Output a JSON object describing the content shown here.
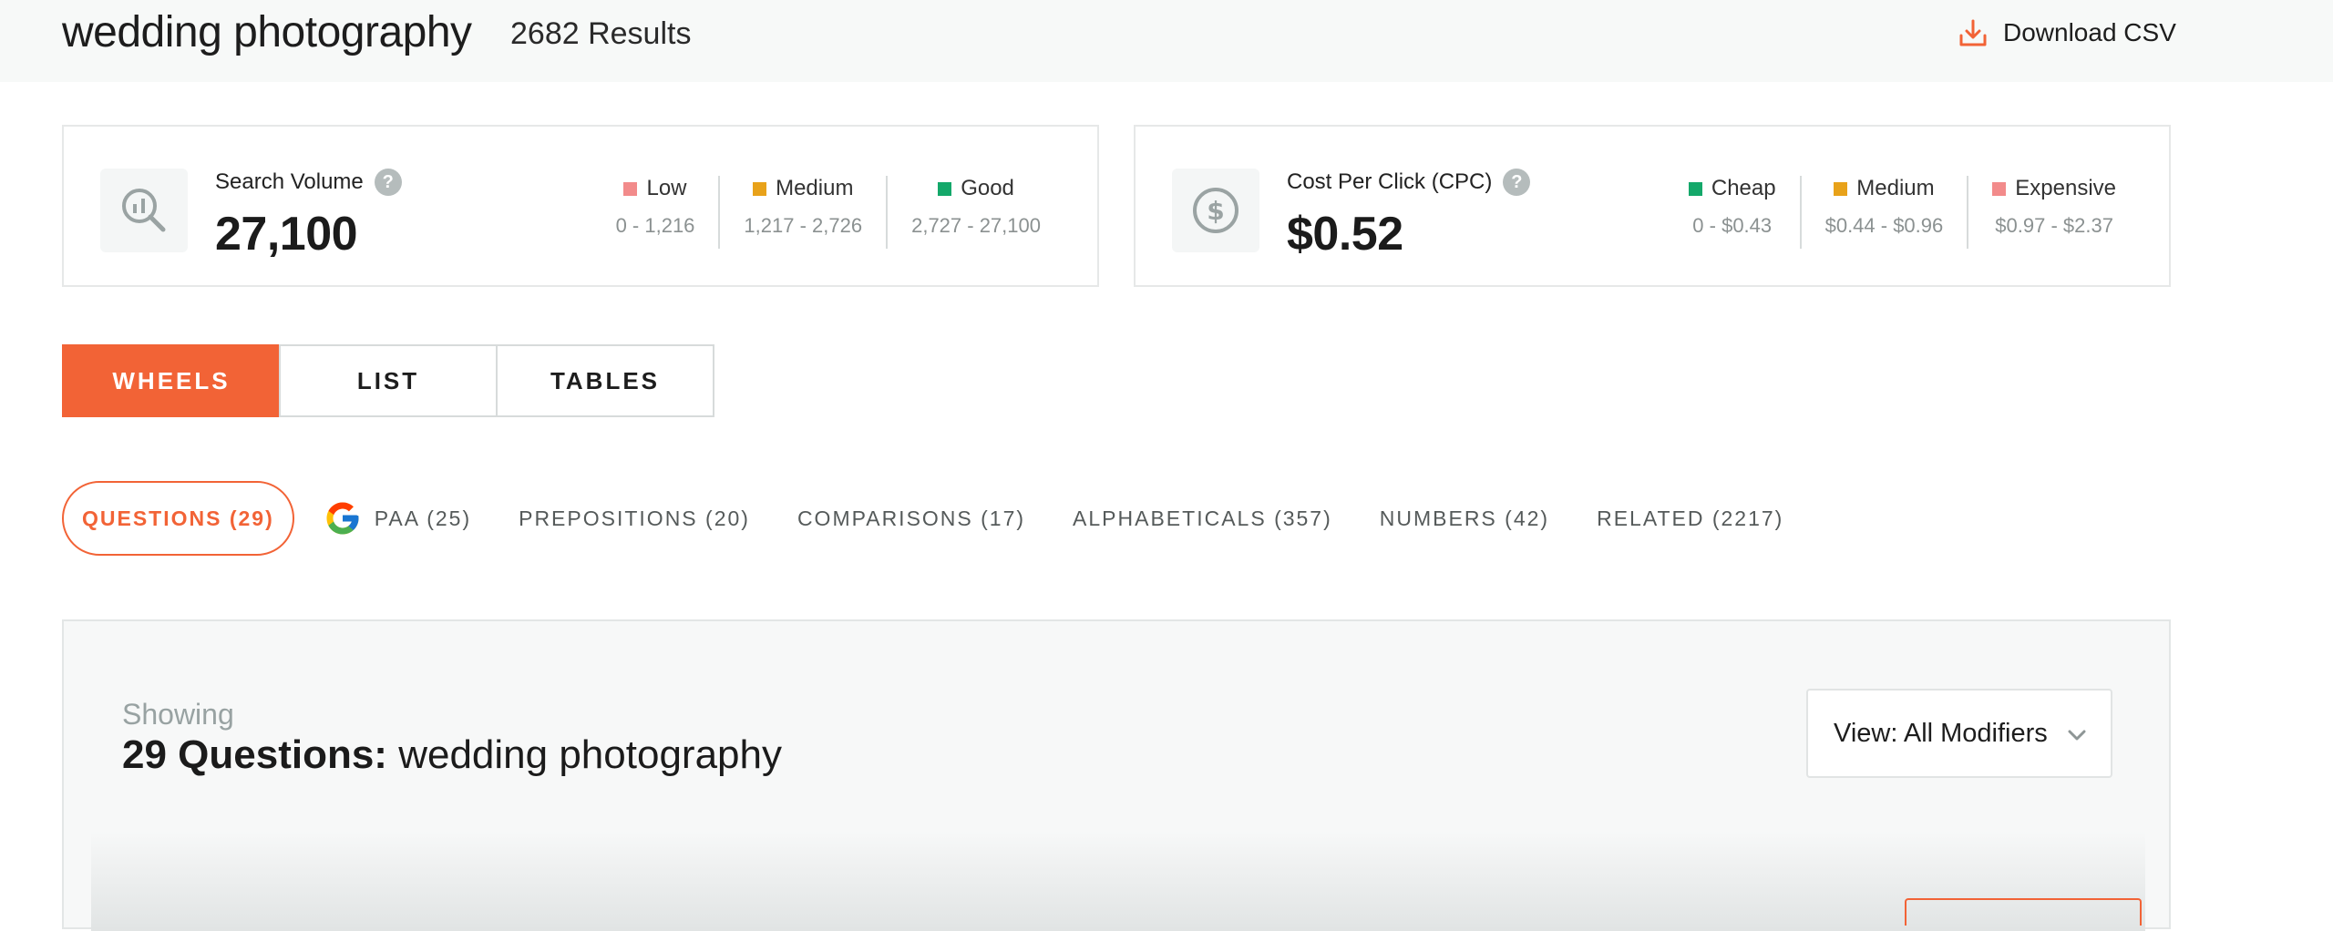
{
  "header": {
    "keyword": "wedding photography",
    "results": "2682 Results",
    "download_label": "Download CSV"
  },
  "search_volume": {
    "label": "Search Volume",
    "value": "27,100",
    "legend": [
      {
        "name": "Low",
        "range": "0 - 1,216",
        "color": "#f28b8b"
      },
      {
        "name": "Medium",
        "range": "1,217 - 2,726",
        "color": "#e8a21a"
      },
      {
        "name": "Good",
        "range": "2,727 - 27,100",
        "color": "#14a86a"
      }
    ]
  },
  "cpc": {
    "label": "Cost Per Click (CPC)",
    "value": "$0.52",
    "legend": [
      {
        "name": "Cheap",
        "range": "0 - $0.43",
        "color": "#14a86a"
      },
      {
        "name": "Medium",
        "range": "$0.44 - $0.96",
        "color": "#e8a21a"
      },
      {
        "name": "Expensive",
        "range": "$0.97 - $2.37",
        "color": "#f28b8b"
      }
    ]
  },
  "view_tabs": [
    {
      "label": "WHEELS",
      "active": true
    },
    {
      "label": "LIST",
      "active": false
    },
    {
      "label": "TABLES",
      "active": false
    }
  ],
  "modifier_tabs": [
    {
      "label": "QUESTIONS (29)",
      "active": true
    },
    {
      "label": "PAA (25)",
      "active": false,
      "icon": "google-icon"
    },
    {
      "label": "PREPOSITIONS (20)",
      "active": false
    },
    {
      "label": "COMPARISONS (17)",
      "active": false
    },
    {
      "label": "ALPHABETICALS (357)",
      "active": false
    },
    {
      "label": "NUMBERS (42)",
      "active": false
    },
    {
      "label": "RELATED (2217)",
      "active": false
    }
  ],
  "panel": {
    "showing": "Showing",
    "headline_bold": "29 Questions:",
    "headline_rest": "wedding photography",
    "dropdown_label": "View: All Modifiers"
  },
  "colors": {
    "accent": "#f26336",
    "good": "#14a86a",
    "medium": "#e8a21a",
    "low": "#f28b8b"
  }
}
